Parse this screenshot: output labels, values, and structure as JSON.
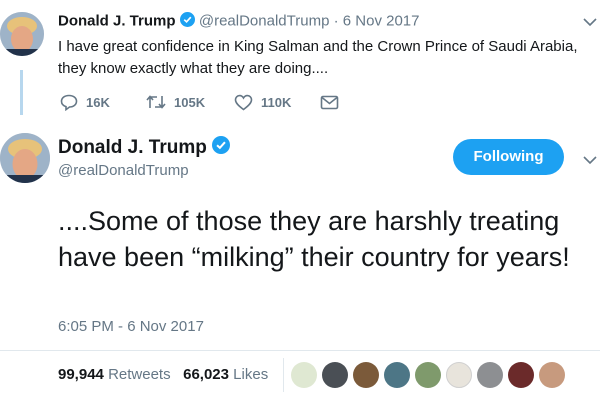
{
  "colors": {
    "accent": "#1da1f2",
    "text": "#14171a",
    "muted": "#657786",
    "thread_line": "#b7d7ee",
    "divider": "#e1e8ed"
  },
  "parent_tweet": {
    "author_name": "Donald J. Trump",
    "handle": "@realDonaldTrump",
    "separator": "·",
    "date": "6 Nov 2017",
    "text_line1": "I have great confidence in King Salman and the Crown Prince of Saudi Arabia,",
    "text_line2": "they know exactly what they are doing....",
    "replies": "16K",
    "retweets": "105K",
    "likes": "110K",
    "icons": [
      "reply-icon",
      "retweet-icon",
      "like-icon",
      "message-icon"
    ]
  },
  "main_tweet": {
    "author_name": "Donald J. Trump",
    "handle": "@realDonaldTrump",
    "follow_label": "Following",
    "text": "....Some of those they are harshly treating have been “milking” their country for years!",
    "timestamp": "6:05 PM - 6 Nov 2017"
  },
  "engagement": {
    "retweet_count": "99,944",
    "retweet_label": "Retweets",
    "like_count": "66,023",
    "like_label": "Likes"
  }
}
